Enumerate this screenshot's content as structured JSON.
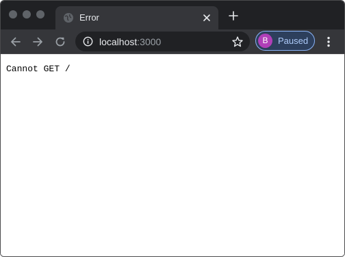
{
  "tab": {
    "title": "Error",
    "favicon": "globe-icon",
    "close_icon": "close-icon"
  },
  "tabbar": {
    "new_tab_icon": "plus-icon"
  },
  "toolbar": {
    "back_icon": "arrow-left-icon",
    "forward_icon": "arrow-right-icon",
    "reload_icon": "reload-icon",
    "site_info_icon": "info-icon",
    "bookmark_icon": "star-icon",
    "menu_icon": "kebab-menu-icon"
  },
  "address_bar": {
    "host": "localhost",
    "port": ":3000"
  },
  "profile": {
    "initial": "B",
    "status": "Paused",
    "avatar_color": "#b03fb8",
    "accent_color": "#8ab4f8"
  },
  "page": {
    "body_text": "Cannot GET /"
  },
  "colors": {
    "frame": "#202124",
    "toolbar": "#35363a",
    "omnibox": "#202124",
    "content": "#ffffff"
  }
}
